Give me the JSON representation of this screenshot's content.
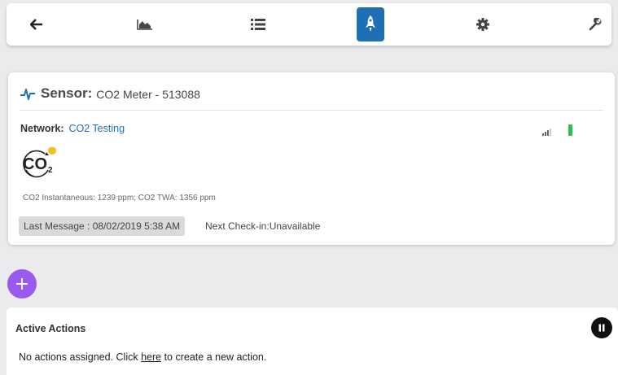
{
  "toolbar": {
    "items": [
      {
        "icon": "arrow-left-icon"
      },
      {
        "icon": "area-chart-icon"
      },
      {
        "icon": "list-icon"
      },
      {
        "icon": "rocket-icon",
        "active": true
      },
      {
        "icon": "gear-icon"
      },
      {
        "icon": "wrench-icon"
      }
    ],
    "active_color": "#1f6fb5"
  },
  "sensor": {
    "label": "Sensor:",
    "name": "CO2 Meter - 513088",
    "network_key": "Network:",
    "network_value": "CO2 Testing",
    "icon": "co2-icon",
    "reading": "CO2 Instantaneous: 1239 ppm; CO2 TWA: 1356 ppm",
    "last_message": "Last Message : 08/02/2019 5:38 AM",
    "next_checkin": "Next Check-in:Unavailable",
    "battery_color": "#2cc44a"
  },
  "add_button": {
    "icon": "plus-icon",
    "color": "#9b59f0"
  },
  "actions": {
    "title": "Active Actions",
    "empty_prefix": "No actions assigned. Click ",
    "empty_link": "here",
    "empty_suffix": " to create a new action."
  }
}
